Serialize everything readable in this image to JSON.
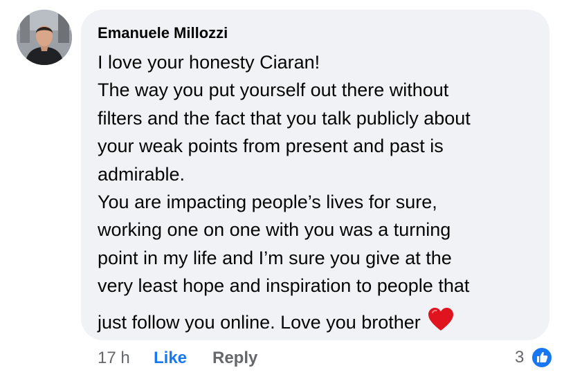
{
  "comment": {
    "author": "Emanuele Millozzi",
    "lines": [
      "I love your honesty Ciaran!",
      "The way you put yourself out there without",
      "filters and the fact that you talk publicly about",
      "your weak points from present and past is",
      "admirable.",
      "You are impacting people’s lives for sure,",
      "working one on one with you was a turning",
      "point in my life and I’m sure you give at the",
      "very least hope and inspiration to people that",
      "just follow you online. Love you brother"
    ],
    "emoji_icon": "red-heart-emoji"
  },
  "actions": {
    "time": "17 h",
    "like_label": "Like",
    "reply_label": "Reply"
  },
  "reactions": {
    "count": "3",
    "icon": "like-reaction-icon",
    "color": "#1877f2"
  },
  "colors": {
    "bubble": "#f0f2f5",
    "text": "#050505",
    "muted": "#65676b",
    "accent": "#1877f2",
    "heart": "#e0141e"
  }
}
